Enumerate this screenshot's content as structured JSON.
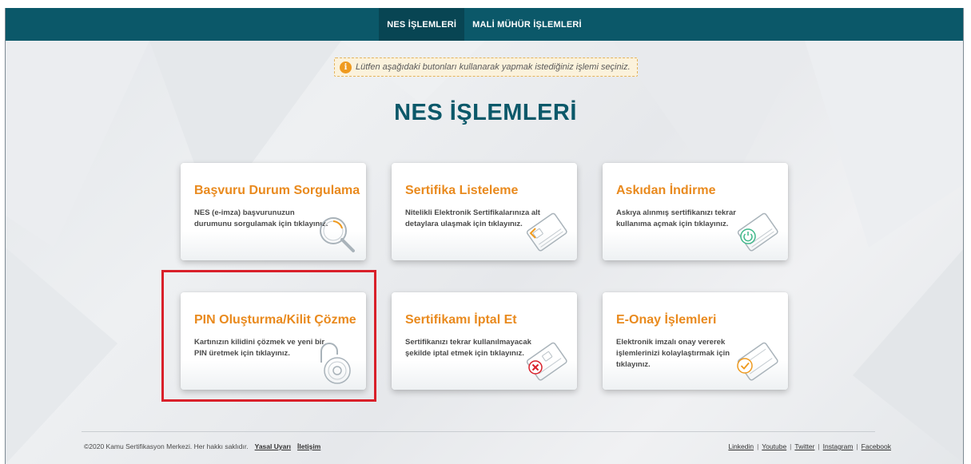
{
  "nav": {
    "items": [
      {
        "label": "NES İŞLEMLERİ",
        "active": true
      },
      {
        "label": "MALİ MÜHÜR İŞLEMLERİ",
        "active": false
      }
    ]
  },
  "notice": {
    "icon": "info-icon",
    "text": "Lütfen aşağıdaki butonları kullanarak yapmak istediğiniz işlemi seçiniz."
  },
  "main": {
    "title": "NES İŞLEMLERİ",
    "cards": [
      {
        "title": "Başvuru Durum Sorgulama",
        "desc": "NES (e-imza) başvurunuzun durumunu sorgulamak için tıklayınız.",
        "icon": "magnifier-icon"
      },
      {
        "title": "Sertifika Listeleme",
        "desc": "Nitelikli Elektronik Sertifikalarınıza alt detaylara ulaşmak için tıklayınız.",
        "icon": "card-list-icon"
      },
      {
        "title": "Askıdan İndirme",
        "desc": "Askıya alınmış sertifikanızı tekrar kullanıma açmak için tıklayınız.",
        "icon": "card-power-icon"
      },
      {
        "title": "PIN Oluşturma/Kilit Çözme",
        "desc": "Kartınızın kilidini çözmek ve yeni bir PIN üretmek için tıklayınız.",
        "icon": "padlock-icon"
      },
      {
        "title": "Sertifikamı İptal Et",
        "desc": "Sertifikanızı tekrar kullanılmayacak şekilde iptal etmek için tıklayınız.",
        "icon": "card-cancel-icon"
      },
      {
        "title": "E-Onay İşlemleri",
        "desc": "Elektronik imzalı onay vererek işlemlerinizi kolaylaştırmak için tıklayınız.",
        "icon": "card-check-icon"
      }
    ]
  },
  "colors": {
    "brand": "#0b5869",
    "accent": "#e98a1e",
    "highlight": "#d9202a"
  },
  "footer": {
    "copyright": "©2020 Kamu Sertifikasyon Merkezi. Her hakkı saklıdır.",
    "links": [
      "Yasal Uyarı",
      "İletişim"
    ],
    "social": [
      "Linkedin",
      "Youtube",
      "Twitter",
      "Instagram",
      "Facebook"
    ]
  }
}
